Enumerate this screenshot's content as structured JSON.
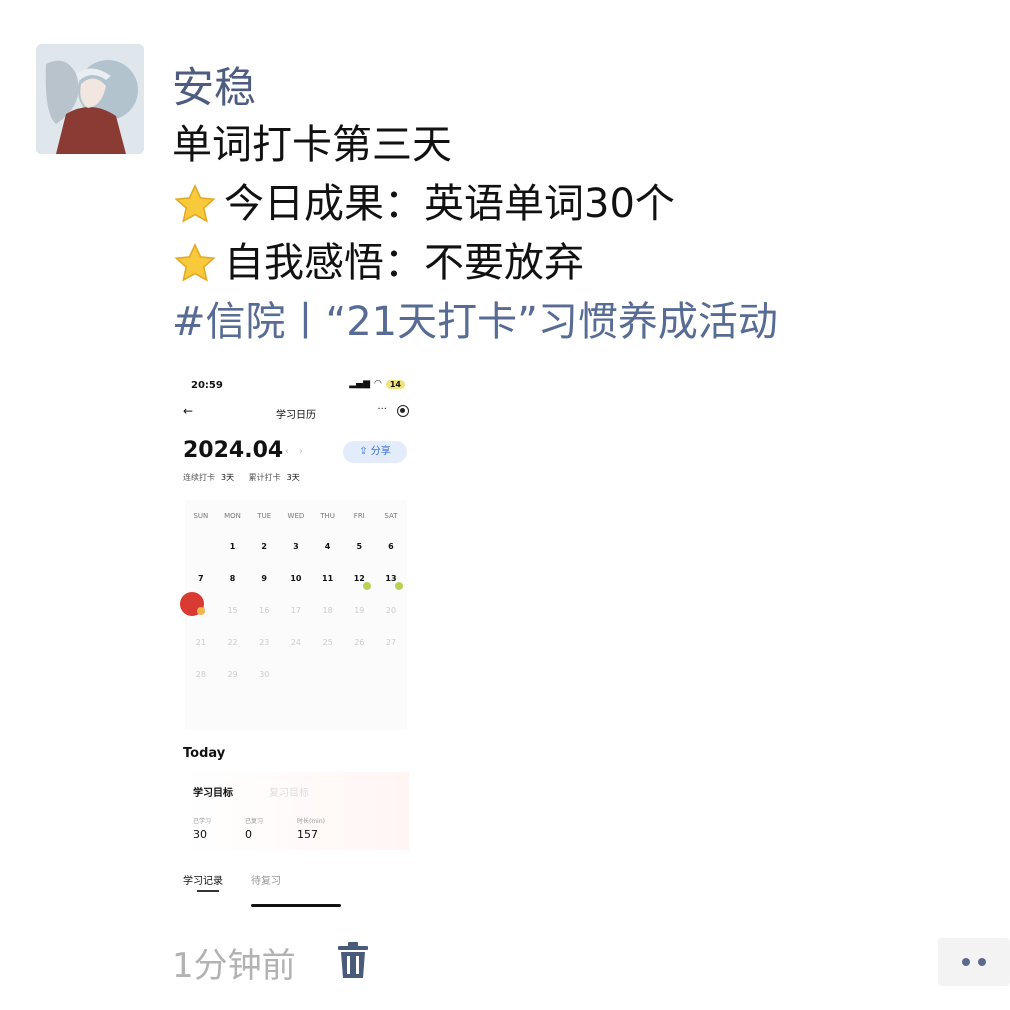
{
  "post": {
    "author": "安稳",
    "lines": [
      "单词打卡第三天",
      "今日成果：英语单词30个",
      "自我感悟：不要放弃"
    ],
    "tag": "#信院丨“21天打卡”习惯养成活动",
    "time": "1分钟前"
  },
  "screenshot": {
    "status_time": "20:59",
    "battery": "14",
    "nav_title": "学习日历",
    "nav_more": "···",
    "month": "2024.04",
    "share_label": "分享",
    "streak_label": "连续打卡",
    "streak_value": "3天",
    "total_label": "累计打卡",
    "total_value": "3天",
    "weekdays": [
      "SUN",
      "MON",
      "TUE",
      "WED",
      "THU",
      "FRI",
      "SAT"
    ],
    "weeks": [
      [
        "",
        "1",
        "2",
        "3",
        "4",
        "5",
        "6"
      ],
      [
        "7",
        "8",
        "9",
        "10",
        "11",
        "12",
        "13"
      ],
      [
        "14",
        "15",
        "16",
        "17",
        "18",
        "19",
        "20"
      ],
      [
        "21",
        "22",
        "23",
        "24",
        "25",
        "26",
        "27"
      ],
      [
        "28",
        "29",
        "30",
        "",
        "",
        "",
        ""
      ]
    ],
    "today_heading": "Today",
    "goal_label": "学习目标",
    "goal_alt": "复习目标",
    "stat_labels": [
      "已学习",
      "已复习",
      "时长(min)"
    ],
    "stat_values": [
      "30",
      "0",
      "157"
    ],
    "tab_active": "学习记录",
    "tab_inactive": "待复习"
  },
  "icons": [
    "star-icon",
    "trash-icon",
    "more-dots-icon",
    "back-arrow-icon",
    "share-icon"
  ],
  "colors": {
    "nickname": "#4d5c80",
    "tag": "#576b95",
    "today": "#d93a32",
    "checkin": "#b7d256"
  }
}
